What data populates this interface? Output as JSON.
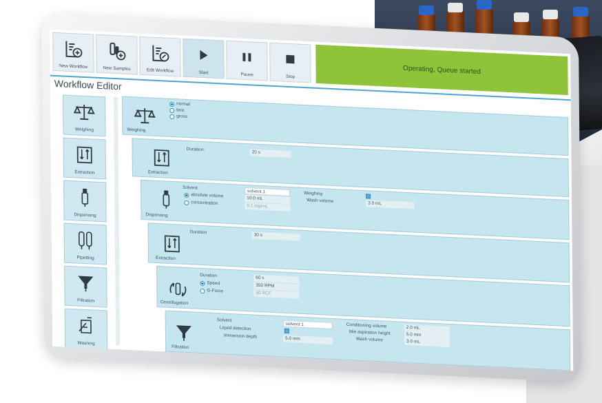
{
  "toolbar": {
    "buttons": [
      {
        "label": "New Workflow",
        "icon": "new-workflow-icon"
      },
      {
        "label": "New Samples",
        "icon": "new-samples-icon"
      },
      {
        "label": "Edit Workflow",
        "icon": "edit-workflow-icon"
      },
      {
        "label": "Start",
        "icon": "play-icon"
      },
      {
        "label": "Pause",
        "icon": "pause-icon"
      },
      {
        "label": "Stop",
        "icon": "stop-icon"
      }
    ],
    "status": "Operating, Queue started",
    "status_color": "#8fc33a"
  },
  "editor_title": "Workflow Editor",
  "sidebar": {
    "items": [
      {
        "label": "Weighing",
        "icon": "scale-icon"
      },
      {
        "label": "Extraction",
        "icon": "extraction-icon"
      },
      {
        "label": "Dispensing",
        "icon": "dispensing-icon"
      },
      {
        "label": "Pipetting",
        "icon": "pipette-icon"
      },
      {
        "label": "Filtration",
        "icon": "funnel-icon"
      },
      {
        "label": "Washing",
        "icon": "washing-icon"
      }
    ]
  },
  "steps": {
    "weighing": {
      "name": "Weighing",
      "modes": [
        "normal",
        "tara",
        "gross"
      ]
    },
    "extraction1": {
      "name": "Extraction",
      "duration_label": "Duration:",
      "duration_value": "20 s"
    },
    "dispensing": {
      "name": "Dispensing",
      "solvent_label": "Solvent",
      "solvent_value": "solvent 1",
      "abs_volume_label": "absolute volume",
      "abs_volume_value": "10.0 mL",
      "concentration_label": "concentration",
      "concentration_value": "0.1 mg/mL",
      "weighing_label": "Weighing",
      "wash_volume_label": "Wash volume",
      "wash_volume_value": "3.0 mL"
    },
    "extraction2": {
      "name": "Extraction",
      "duration_label": "Duration",
      "duration_value": "30 s"
    },
    "centrifugation": {
      "name": "Centrifugation",
      "duration_label": "Duration",
      "duration_value": "60 s",
      "speed_label": "Speed",
      "speed_value": "350 RPM",
      "gforce_label": "G-Force",
      "gforce_value": "50 RCF"
    },
    "filtration": {
      "name": "Filtration",
      "solvent_label": "Solvent",
      "solvent_value": "solvent 1",
      "liquid_label": "Liquid detection",
      "immersion_label": "Immersion depth",
      "immersion_value": "5.0 mm",
      "conditioning_label": "Conditioning volume",
      "conditioning_value": "2.0 mL",
      "min_asp_label": "Min aspiration height",
      "min_asp_value": "5.0 mm",
      "wash_label": "Wash volume",
      "wash_value": "3.0 mL"
    }
  }
}
